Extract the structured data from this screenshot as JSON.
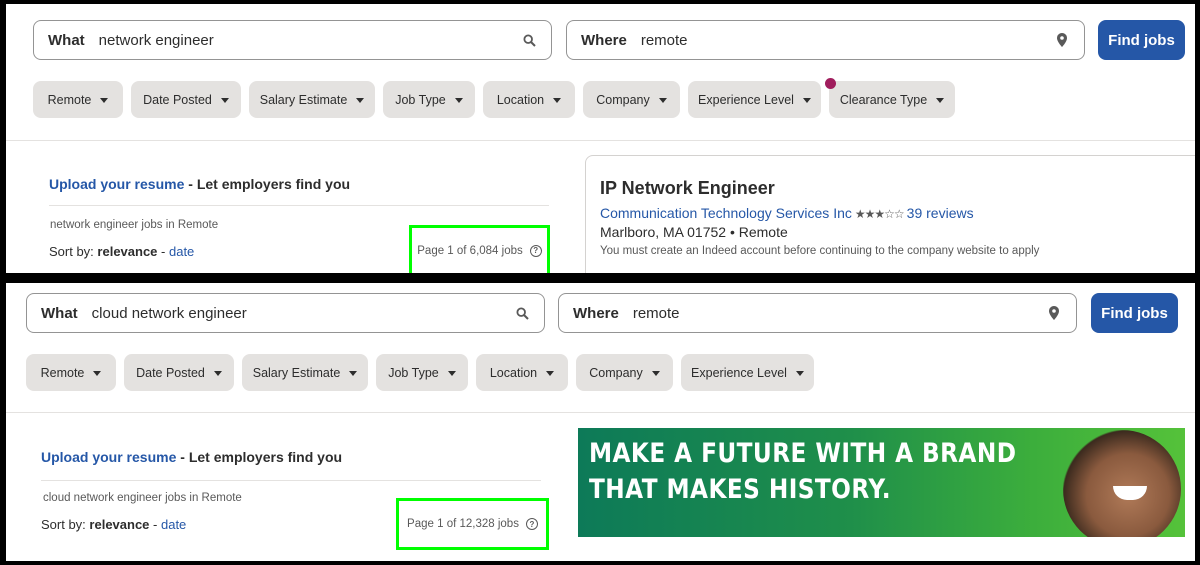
{
  "top": {
    "search": {
      "what_label": "What",
      "what_value": "network engineer",
      "where_label": "Where",
      "where_value": "remote",
      "find_button": "Find jobs"
    },
    "filters": [
      "Remote",
      "Date Posted",
      "Salary Estimate",
      "Job Type",
      "Location",
      "Company",
      "Experience Level",
      "Clearance Type"
    ],
    "upload": {
      "link": "Upload your resume",
      "rest": " - Let employers find you"
    },
    "jobs_in": "network engineer jobs in Remote",
    "sort": {
      "prefix": "Sort by: ",
      "relevance": "relevance",
      "sep": " - ",
      "date": "date"
    },
    "page_count": "Page 1 of 6,084 jobs",
    "job": {
      "title": "IP Network Engineer",
      "company": "Communication Technology Services Inc",
      "rating": 3.5,
      "stars": "★★★☆☆",
      "reviews": "39 reviews",
      "location": "Marlboro, MA 01752  •  Remote",
      "note": "You must create an Indeed account before continuing to the company website to apply"
    }
  },
  "bottom": {
    "search": {
      "what_label": "What",
      "what_value": "cloud network engineer",
      "where_label": "Where",
      "where_value": "remote",
      "find_button": "Find jobs"
    },
    "filters": [
      "Remote",
      "Date Posted",
      "Salary Estimate",
      "Job Type",
      "Location",
      "Company",
      "Experience Level"
    ],
    "upload": {
      "link": "Upload your resume",
      "rest": " - Let employers find you"
    },
    "jobs_in": "cloud network engineer jobs in Remote",
    "sort": {
      "prefix": "Sort by: ",
      "relevance": "relevance",
      "sep": " - ",
      "date": "date"
    },
    "page_count": "Page 1 of 12,328 jobs",
    "banner": {
      "line1": "MAKE A FUTURE WITH A BRAND",
      "line2": "THAT MAKES HISTORY."
    }
  },
  "colors": {
    "accent": "#2557a7",
    "highlight": "#00ff00",
    "chip_bg": "#e4e2e0",
    "badge_dot": "#a01d5d"
  },
  "icons": {
    "search": "search-icon",
    "location": "location-pin-icon",
    "help": "question-circle-icon",
    "dropdown": "caret-down-icon"
  }
}
